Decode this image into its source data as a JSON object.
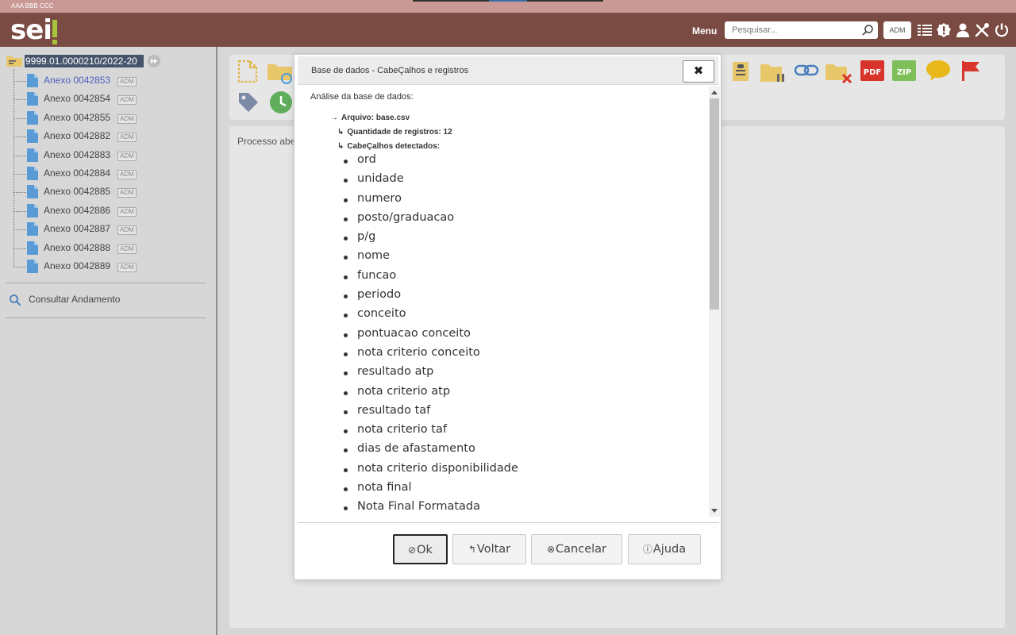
{
  "top_strip": {
    "org_name": "AAA BBB CCC"
  },
  "header": {
    "menu_label": "Menu",
    "search_placeholder": "Pesquisar...",
    "user_badge": "ADM"
  },
  "sidebar": {
    "process_number": "9999.01.0000210/2022-20",
    "documents": [
      {
        "label": "Anexo 0042853",
        "badge": "ADM"
      },
      {
        "label": "Anexo 0042854",
        "badge": "ADM"
      },
      {
        "label": "Anexo 0042855",
        "badge": "ADM"
      },
      {
        "label": "Anexo 0042882",
        "badge": "ADM"
      },
      {
        "label": "Anexo 0042883",
        "badge": "ADM"
      },
      {
        "label": "Anexo 0042884",
        "badge": "ADM"
      },
      {
        "label": "Anexo 0042885",
        "badge": "ADM"
      },
      {
        "label": "Anexo 0042886",
        "badge": "ADM"
      },
      {
        "label": "Anexo 0042887",
        "badge": "ADM"
      },
      {
        "label": "Anexo 0042888",
        "badge": "ADM"
      },
      {
        "label": "Anexo 0042889",
        "badge": "ADM"
      }
    ],
    "consult_label": "Consultar Andamento"
  },
  "content": {
    "status_text": "Processo abe"
  },
  "modal": {
    "title": "Base de dados - CabeÇalhos e registros",
    "close_glyph": "✖",
    "intro": "Análise da base de dados:",
    "file_line": "Arquivo: base.csv",
    "records_line": "Quantidade de registros: 12",
    "headers_line": "CabeÇalhos detectados:",
    "headers": [
      "ord",
      "unidade",
      "numero",
      "posto/graduacao",
      "p/g",
      "nome",
      "funcao",
      "periodo",
      "conceito",
      "pontuacao conceito",
      "nota criterio conceito",
      "resultado atp",
      "nota criterio atp",
      "resultado taf",
      "nota criterio taf",
      "dias de afastamento",
      "nota criterio disponibilidade",
      "nota final",
      "Nota Final Formatada"
    ],
    "buttons": {
      "ok": "Ok",
      "back": "Voltar",
      "cancel": "Cancelar",
      "help": "Ajuda"
    }
  },
  "colors": {
    "header_bg": "#7a4b43",
    "top_strip": "#c99a95",
    "selected_process_bg": "#46546b",
    "active_doc_link": "#4a5ec0",
    "doc_icon": "#5b9bd5",
    "logo_accent": "#a8c43a"
  }
}
